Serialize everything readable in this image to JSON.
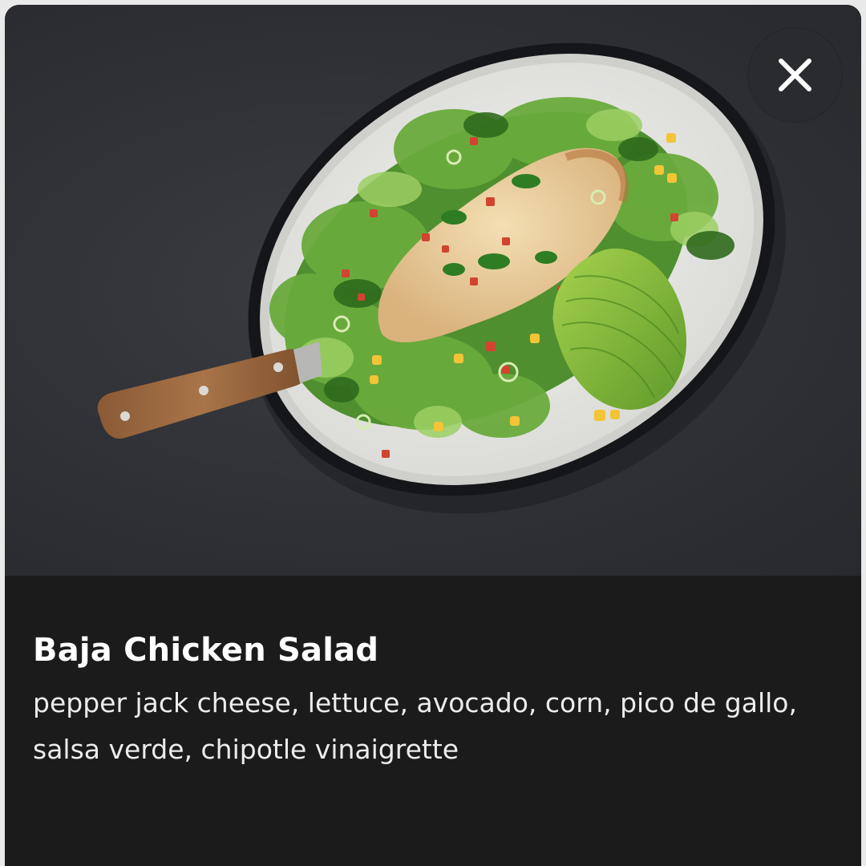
{
  "close_button": {
    "icon": "close-icon",
    "label": "Close"
  },
  "item": {
    "name": "Baja Chicken Salad",
    "ingredients": "pepper jack cheese, lettuce, avocado, corn, pico de gallo, salsa verde, chipotle vinaigrette"
  },
  "colors": {
    "card_background": "#1c1b1c",
    "close_button_background": "#2a2b2f",
    "title_text": "#ffffff",
    "description_text": "#ececec"
  }
}
